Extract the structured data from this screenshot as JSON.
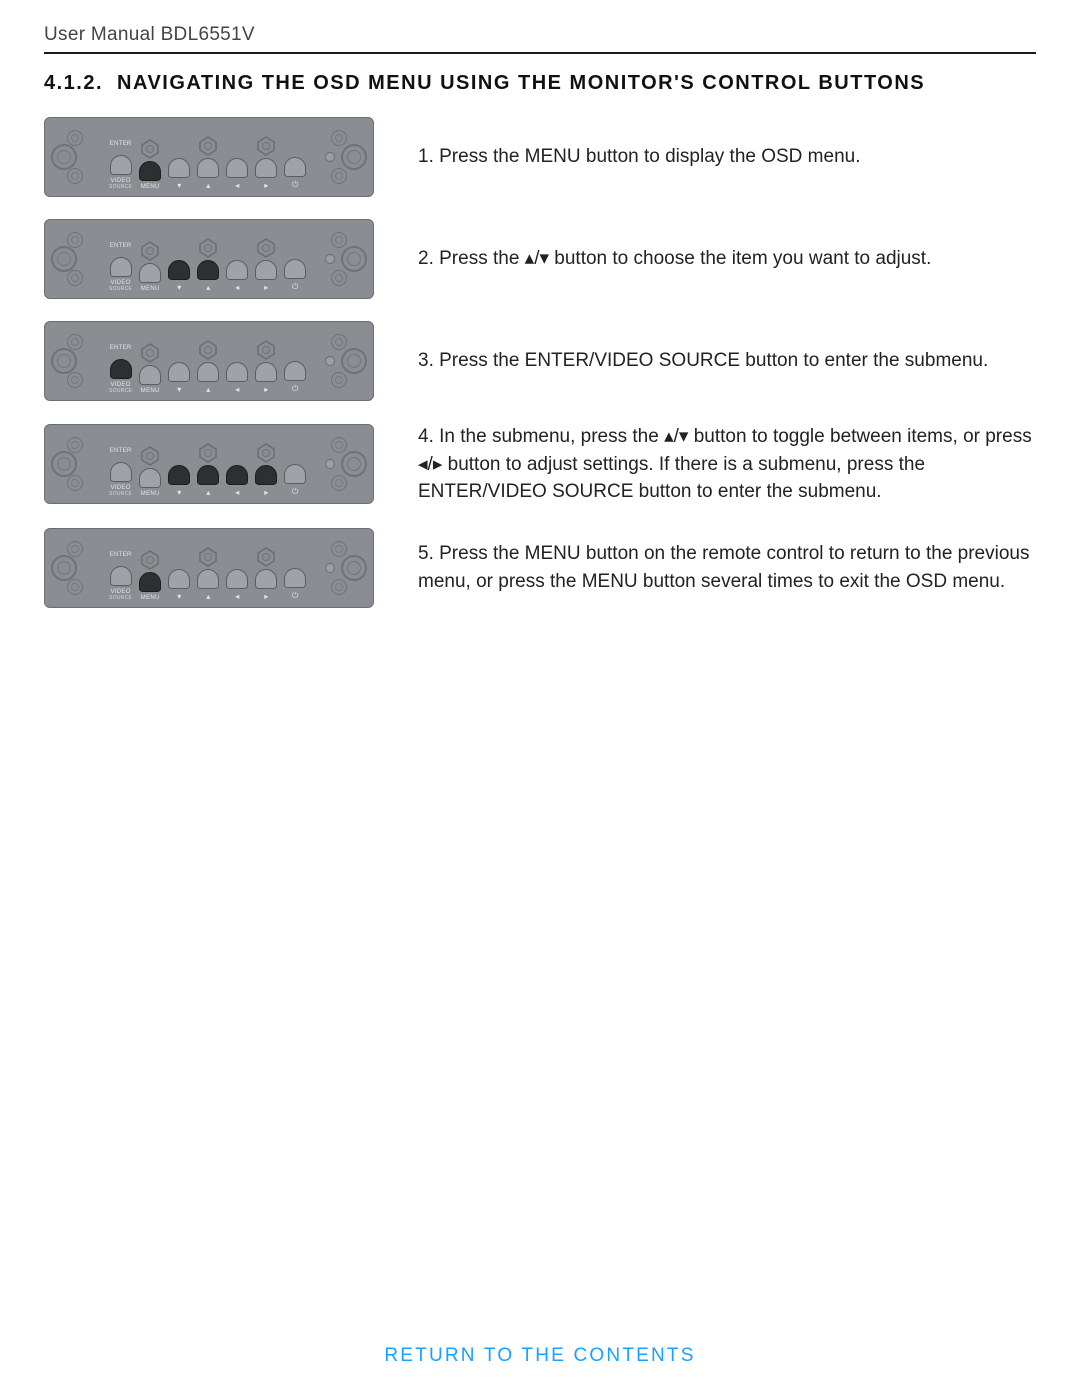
{
  "doc_header": "User Manual BDL6551V",
  "section": {
    "number": "4.1.2.",
    "title": "NAVIGATING THE OSD MENU USING THE MONITOR'S CONTROL BUTTONS"
  },
  "panel_labels": {
    "enter": "ENTER",
    "video_source": "VIDEO\nSOURCE",
    "menu": "MENU",
    "down": "▾",
    "up": "▴",
    "left": "◂",
    "right": "▸",
    "power": "⏻"
  },
  "steps": [
    {
      "n": "1.",
      "text": "Press the MENU button to display the OSD menu.",
      "pressed": [
        "menu"
      ]
    },
    {
      "n": "2.",
      "text": "Press the ▴/▾ button to choose the item you want to adjust.",
      "pressed": [
        "down",
        "up"
      ]
    },
    {
      "n": "3.",
      "text": "Press the ENTER/VIDEO SOURCE button to enter the submenu.",
      "pressed": [
        "enter"
      ]
    },
    {
      "n": "4.",
      "text": "In the submenu, press the ▴/▾ button to toggle between items, or press ◂/▸ button to adjust settings. If there is a submenu, press the ENTER/VIDEO SOURCE button to enter the submenu.",
      "pressed": [
        "down",
        "up",
        "left",
        "right"
      ]
    },
    {
      "n": "5.",
      "text": "Press the MENU button on the remote control to return to the previous menu, or press the MENU button several times to exit the OSD menu.",
      "pressed": [
        "menu"
      ]
    }
  ],
  "return_link": "RETURN TO THE CONTENTS"
}
